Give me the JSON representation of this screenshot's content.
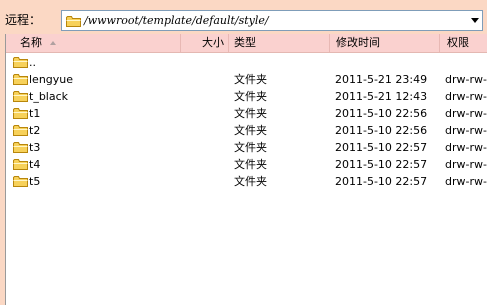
{
  "pathbar": {
    "label": "远程：",
    "path": "/wwwroot/template/default/style/"
  },
  "columns": {
    "name": "名称",
    "size": "大小",
    "type": "类型",
    "modified": "修改时间",
    "perms": "权限"
  },
  "rows": [
    {
      "name": "..",
      "type": "",
      "modified": "",
      "perms": ""
    },
    {
      "name": "lengyue",
      "type": "文件夹",
      "modified": "2011-5-21 23:49",
      "perms": "drw-rw-r"
    },
    {
      "name": "t_black",
      "type": "文件夹",
      "modified": "2011-5-21 12:43",
      "perms": "drw-rw-r"
    },
    {
      "name": "t1",
      "type": "文件夹",
      "modified": "2011-5-10 22:56",
      "perms": "drw-rw-r"
    },
    {
      "name": "t2",
      "type": "文件夹",
      "modified": "2011-5-10 22:56",
      "perms": "drw-rw-r"
    },
    {
      "name": "t3",
      "type": "文件夹",
      "modified": "2011-5-10 22:57",
      "perms": "drw-rw-r"
    },
    {
      "name": "t4",
      "type": "文件夹",
      "modified": "2011-5-10 22:57",
      "perms": "drw-rw-r"
    },
    {
      "name": "t5",
      "type": "文件夹",
      "modified": "2011-5-10 22:57",
      "perms": "drw-rw-r"
    }
  ],
  "colors": {
    "background": "#fbd8c4",
    "header": "#fad1cf",
    "folder_fill": "#f7d15a",
    "folder_stroke": "#b8860b"
  }
}
